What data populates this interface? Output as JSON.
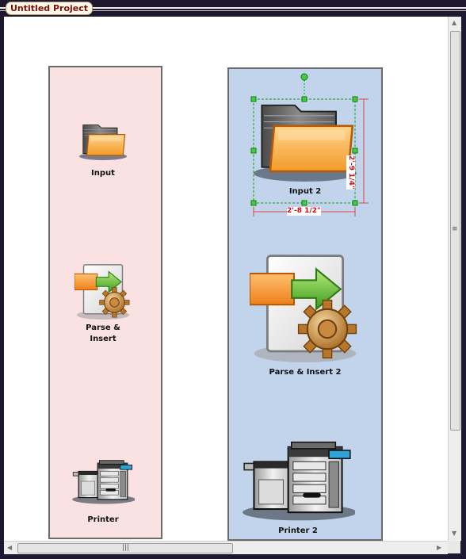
{
  "window": {
    "title": "Untitled Project"
  },
  "lanes": {
    "left": {
      "input_label": "Input",
      "parse_label_line1": "Parse &",
      "parse_label_line2": "Insert",
      "printer_label": "Printer"
    },
    "right": {
      "input_label": "Input 2",
      "parse_label": "Parse & Insert 2",
      "printer_label": "Printer 2"
    }
  },
  "selection": {
    "width_label": "2'-8 1/2\"",
    "height_label": "2'-9 1/4\""
  },
  "icons": {
    "folder": "folder-icon",
    "parse": "document-gear-icon",
    "printer": "printer-icon"
  },
  "colors": {
    "lane_left": "#fae2e2",
    "lane_right": "#c2d4ec",
    "selection": "#16a016",
    "dimension": "#cc1010",
    "title_text": "#7a1010"
  }
}
